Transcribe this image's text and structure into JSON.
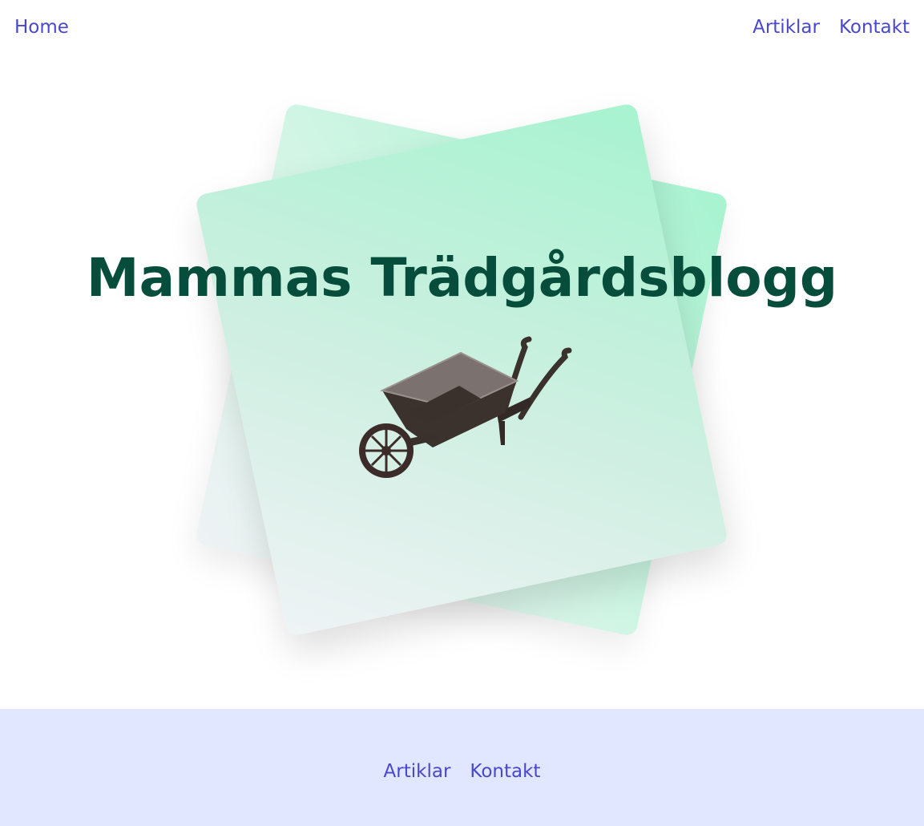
{
  "nav": {
    "home_label": "Home",
    "links": [
      "Artiklar",
      "Kontakt"
    ]
  },
  "hero": {
    "title": "Mammas Trädgårdsblogg",
    "image_icon": "wheelbarrow-icon"
  },
  "footer": {
    "links": [
      "Artiklar",
      "Kontakt"
    ]
  },
  "colors": {
    "link": "#4a47cf",
    "title": "#064e3b",
    "card_accent": "#a7f3d0",
    "footer_bg": "#e0e7ff"
  }
}
